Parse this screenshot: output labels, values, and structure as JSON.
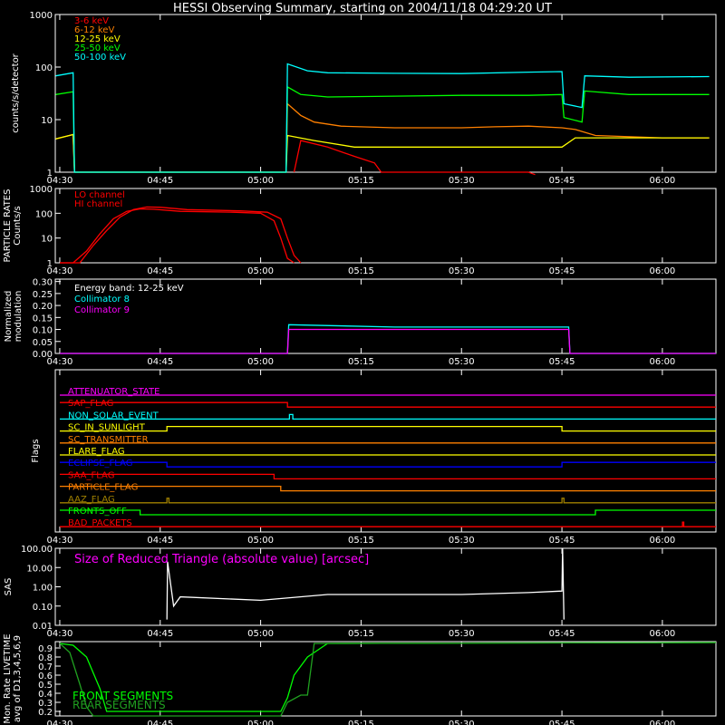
{
  "title": "HESSI Observing Summary, starting on 2004/11/18 04:29:20 UT",
  "x_ticks": [
    "04:30",
    "04:45",
    "05:00",
    "05:15",
    "05:30",
    "05:45",
    "06:00"
  ],
  "colors": {
    "red": "#ff0000",
    "orange": "#ff8000",
    "yellow": "#ffff00",
    "green": "#00ff00",
    "cyan": "#00ffff",
    "magenta": "#ff00ff",
    "blue": "#0000ff",
    "white": "#ffffff",
    "olive": "#a08000",
    "darkgreen": "#20a020"
  },
  "panels": {
    "counts": {
      "ylabel": "counts/s/detector",
      "y_ticks": [
        "1000",
        "100",
        "10",
        "1"
      ],
      "legend": [
        "3-6 keV",
        "6-12 keV",
        "12-25 keV",
        "25-50 keV",
        "50-100 keV"
      ]
    },
    "particle": {
      "ylabel_1": "PARTICLE RATES",
      "ylabel_2": "Counts/s",
      "y_ticks": [
        "1000",
        "100",
        "10",
        "1"
      ],
      "legend": [
        "LO channel",
        "HI channel"
      ]
    },
    "modulation": {
      "ylabel_1": "Normalized",
      "ylabel_2": "modulation",
      "y_ticks": [
        "0.30",
        "0.25",
        "0.20",
        "0.15",
        "0.10",
        "0.05",
        "0.00"
      ],
      "legend": [
        "Energy band: 12-25 keV",
        "Collimator 8",
        "Collimator 9"
      ]
    },
    "flags": {
      "ylabel": "Flags",
      "items": [
        "ATTENUATOR_STATE",
        "SAP_FLAG",
        "NON_SOLAR_EVENT",
        "SC_IN_SUNLIGHT",
        "SC_TRANSMITTER",
        "FLARE_FLAG",
        "ECLIPSE_FLAG",
        "SAA_FLAG",
        "PARTICLE_FLAG",
        "AAZ_FLAG",
        "FRONTS_OFF",
        "BAD_PACKETS"
      ]
    },
    "sas": {
      "ylabel": "SAS",
      "y_ticks": [
        "100.00",
        "10.00",
        "1.00",
        "0.10",
        "0.01"
      ],
      "legend": "Size of Reduced Triangle (absolute value) [arcsec]"
    },
    "livetime": {
      "ylabel_1": "Mon. Rate LIVETIME",
      "ylabel_2": "avg of D1,3,4,5,6,9",
      "y_ticks": [
        "0.9",
        "0.8",
        "0.7",
        "0.6",
        "0.5",
        "0.4",
        "0.3",
        "0.2"
      ],
      "legend": [
        "FRONT SEGMENTS",
        "REAR SEGMENTS"
      ]
    }
  },
  "chart_data": [
    {
      "type": "line",
      "name": "counts",
      "ylabel": "counts/s/detector",
      "yscale": "log",
      "ylim": [
        1,
        1000
      ],
      "xlim_minutes_after_04_30": [
        -0.67,
        98
      ],
      "series": [
        {
          "name": "3-6 keV",
          "color": "#ff0000",
          "points": [
            [
              35,
              1
            ],
            [
              36,
              4
            ],
            [
              40,
              3
            ],
            [
              44,
              2
            ],
            [
              47,
              1.5
            ],
            [
              48,
              1
            ],
            [
              70,
              1
            ],
            [
              71,
              0.9
            ]
          ]
        },
        {
          "name": "6-12 keV",
          "color": "#ff8000",
          "points": [
            [
              -0.6,
              4.3
            ],
            [
              2,
              5.2
            ],
            [
              2.2,
              1
            ],
            [
              33.8,
              1
            ],
            [
              34,
              20
            ],
            [
              36,
              12
            ],
            [
              38,
              9
            ],
            [
              42,
              7.5
            ],
            [
              50,
              7
            ],
            [
              60,
              7
            ],
            [
              65,
              7.3
            ],
            [
              70,
              7.5
            ],
            [
              75,
              7
            ],
            [
              77,
              6.5
            ],
            [
              80,
              5
            ],
            [
              90,
              4.5
            ],
            [
              97,
              4.5
            ]
          ]
        },
        {
          "name": "12-25 keV",
          "color": "#ffff00",
          "points": [
            [
              -0.6,
              4.3
            ],
            [
              2,
              5.2
            ],
            [
              2.2,
              1
            ],
            [
              33.8,
              1
            ],
            [
              34,
              5
            ],
            [
              38,
              4
            ],
            [
              44,
              3
            ],
            [
              50,
              3
            ],
            [
              60,
              3
            ],
            [
              70,
              3
            ],
            [
              75,
              3
            ],
            [
              77,
              4.5
            ],
            [
              82,
              4.5
            ],
            [
              90,
              4.5
            ],
            [
              97,
              4.5
            ]
          ]
        },
        {
          "name": "25-50 keV",
          "color": "#00ff00",
          "points": [
            [
              -0.6,
              30
            ],
            [
              2,
              34
            ],
            [
              2.2,
              1
            ],
            [
              33.8,
              1
            ],
            [
              34,
              42
            ],
            [
              36,
              30
            ],
            [
              40,
              27
            ],
            [
              50,
              28
            ],
            [
              60,
              29
            ],
            [
              70,
              29
            ],
            [
              75,
              30
            ],
            [
              75.3,
              11
            ],
            [
              78,
              9
            ],
            [
              78.4,
              35
            ],
            [
              85,
              30
            ],
            [
              97,
              30
            ]
          ]
        },
        {
          "name": "50-100 keV",
          "color": "#00ffff",
          "points": [
            [
              -0.6,
              68
            ],
            [
              2,
              78
            ],
            [
              2.2,
              1
            ],
            [
              33.8,
              1
            ],
            [
              34,
              115
            ],
            [
              37,
              85
            ],
            [
              40,
              78
            ],
            [
              50,
              76
            ],
            [
              60,
              75
            ],
            [
              70,
              80
            ],
            [
              75,
              82
            ],
            [
              75.3,
              20
            ],
            [
              78,
              17
            ],
            [
              78.4,
              68
            ],
            [
              85,
              64
            ],
            [
              97,
              66
            ]
          ]
        }
      ]
    },
    {
      "type": "line",
      "name": "particle_rates",
      "yscale": "log",
      "ylim": [
        1,
        1000
      ],
      "series": [
        {
          "name": "LO channel",
          "color": "#ff0000",
          "points": [
            [
              0,
              1
            ],
            [
              2,
              1
            ],
            [
              4,
              3
            ],
            [
              6,
              15
            ],
            [
              8,
              60
            ],
            [
              10,
              120
            ],
            [
              12,
              150
            ],
            [
              14,
              145
            ],
            [
              18,
              120
            ],
            [
              26,
              110
            ],
            [
              30,
              100
            ],
            [
              32,
              50
            ],
            [
              33,
              10
            ],
            [
              34,
              1.5
            ],
            [
              35,
              1
            ]
          ]
        },
        {
          "name": "HI channel",
          "color": "#ff0000",
          "points": [
            [
              0,
              1
            ],
            [
              3,
              1
            ],
            [
              5,
              5
            ],
            [
              7,
              20
            ],
            [
              9,
              70
            ],
            [
              11,
              140
            ],
            [
              13,
              180
            ],
            [
              15,
              175
            ],
            [
              19,
              140
            ],
            [
              27,
              125
            ],
            [
              31,
              110
            ],
            [
              33,
              60
            ],
            [
              34,
              10
            ],
            [
              35,
              2
            ],
            [
              36,
              1
            ]
          ]
        }
      ]
    },
    {
      "type": "line",
      "name": "modulation",
      "ylim": [
        0,
        0.3
      ],
      "series": [
        {
          "name": "Collimator 8",
          "color": "#00ffff",
          "points": [
            [
              0,
              0
            ],
            [
              34,
              0
            ],
            [
              34.2,
              0.12
            ],
            [
              50,
              0.11
            ],
            [
              76,
              0.11
            ],
            [
              76.2,
              0
            ],
            [
              98,
              0
            ]
          ]
        },
        {
          "name": "Collimator 9",
          "color": "#ff00ff",
          "points": [
            [
              0,
              0
            ],
            [
              34,
              0
            ],
            [
              34.2,
              0.1
            ],
            [
              50,
              0.1
            ],
            [
              76,
              0.1
            ],
            [
              76.2,
              0
            ],
            [
              98,
              0
            ]
          ]
        }
      ]
    },
    {
      "type": "line",
      "name": "flags",
      "series": [
        {
          "name": "ATTENUATOR_STATE",
          "color": "#ff00ff",
          "points": [
            [
              0,
              0
            ],
            [
              98,
              0
            ]
          ]
        },
        {
          "name": "SAP_FLAG",
          "color": "#ff0000",
          "points": [
            [
              0,
              1
            ],
            [
              34,
              1
            ],
            [
              34,
              0
            ],
            [
              98,
              0
            ]
          ]
        },
        {
          "name": "NON_SOLAR_EVENT",
          "color": "#00ffff",
          "points": [
            [
              0,
              0
            ],
            [
              34.3,
              0
            ],
            [
              34.3,
              1
            ],
            [
              34.8,
              1
            ],
            [
              34.8,
              0
            ],
            [
              98,
              0
            ]
          ]
        },
        {
          "name": "SC_IN_SUNLIGHT",
          "color": "#ffff00",
          "points": [
            [
              0,
              0
            ],
            [
              16,
              0
            ],
            [
              16,
              1
            ],
            [
              75,
              1
            ],
            [
              75,
              0
            ],
            [
              98,
              0
            ]
          ]
        },
        {
          "name": "SC_TRANSMITTER",
          "color": "#ff8000",
          "points": [
            [
              0,
              0
            ],
            [
              98,
              0
            ]
          ]
        },
        {
          "name": "FLARE_FLAG",
          "color": "#ffff00",
          "points": [
            [
              0,
              0
            ],
            [
              98,
              0
            ]
          ]
        },
        {
          "name": "ECLIPSE_FLAG",
          "color": "#0000ff",
          "points": [
            [
              0,
              1
            ],
            [
              16,
              1
            ],
            [
              16,
              0
            ],
            [
              75,
              0
            ],
            [
              75,
              1
            ],
            [
              98,
              1
            ]
          ]
        },
        {
          "name": "SAA_FLAG",
          "color": "#ff0000",
          "points": [
            [
              0,
              1
            ],
            [
              32,
              1
            ],
            [
              32,
              0
            ],
            [
              98,
              0
            ]
          ]
        },
        {
          "name": "PARTICLE_FLAG",
          "color": "#ff8000",
          "points": [
            [
              0,
              1
            ],
            [
              33,
              1
            ],
            [
              33,
              0
            ],
            [
              98,
              0
            ]
          ]
        },
        {
          "name": "AAZ_FLAG",
          "color": "#a08000",
          "points": [
            [
              0,
              0
            ],
            [
              16,
              0
            ],
            [
              16,
              1
            ],
            [
              16.3,
              1
            ],
            [
              16.3,
              0
            ],
            [
              75,
              0
            ],
            [
              75,
              1
            ],
            [
              75.3,
              1
            ],
            [
              75.3,
              0
            ],
            [
              98,
              0
            ]
          ]
        },
        {
          "name": "FRONTS_OFF",
          "color": "#00ff00",
          "points": [
            [
              0,
              1
            ],
            [
              12,
              1
            ],
            [
              12,
              0
            ],
            [
              80,
              0
            ],
            [
              80,
              1
            ],
            [
              98,
              1
            ]
          ]
        },
        {
          "name": "BAD_PACKETS",
          "color": "#ff0000",
          "points": [
            [
              0,
              0
            ],
            [
              93,
              0
            ],
            [
              93,
              1
            ],
            [
              93.2,
              1
            ],
            [
              93.2,
              0
            ],
            [
              98,
              0
            ]
          ]
        }
      ]
    },
    {
      "type": "line",
      "name": "sas",
      "yscale": "log",
      "ylim": [
        0.01,
        100
      ],
      "series": [
        {
          "name": "Size of Reduced Triangle (absolute value) [arcsec]",
          "color": "#ffffff",
          "points": [
            [
              16,
              0.02
            ],
            [
              16.1,
              20
            ],
            [
              17,
              0.1
            ],
            [
              18,
              0.3
            ],
            [
              30,
              0.2
            ],
            [
              40,
              0.4
            ],
            [
              50,
              0.4
            ],
            [
              60,
              0.4
            ],
            [
              70,
              0.5
            ],
            [
              75,
              0.6
            ],
            [
              75.1,
              100
            ],
            [
              75.3,
              0.02
            ]
          ]
        }
      ]
    },
    {
      "type": "line",
      "name": "livetime",
      "ylim": [
        0.15,
        0.97
      ],
      "series": [
        {
          "name": "FRONT SEGMENTS",
          "color": "#00ff00",
          "points": [
            [
              0,
              0.95
            ],
            [
              2,
              0.93
            ],
            [
              4,
              0.8
            ],
            [
              6,
              0.45
            ],
            [
              7,
              0.2
            ],
            [
              33,
              0.2
            ],
            [
              34,
              0.35
            ],
            [
              35,
              0.6
            ],
            [
              37,
              0.8
            ],
            [
              39,
              0.9
            ],
            [
              40,
              0.95
            ],
            [
              98,
              0.96
            ]
          ]
        },
        {
          "name": "REAR SEGMENTS",
          "color": "#20a020",
          "points": [
            [
              0,
              0.95
            ],
            [
              1.5,
              0.85
            ],
            [
              3,
              0.5
            ],
            [
              4,
              0.25
            ],
            [
              5,
              0.15
            ],
            [
              33,
              0.15
            ],
            [
              34,
              0.3
            ],
            [
              36,
              0.38
            ],
            [
              37,
              0.38
            ],
            [
              38,
              0.95
            ],
            [
              98,
              0.96
            ]
          ]
        }
      ]
    }
  ]
}
